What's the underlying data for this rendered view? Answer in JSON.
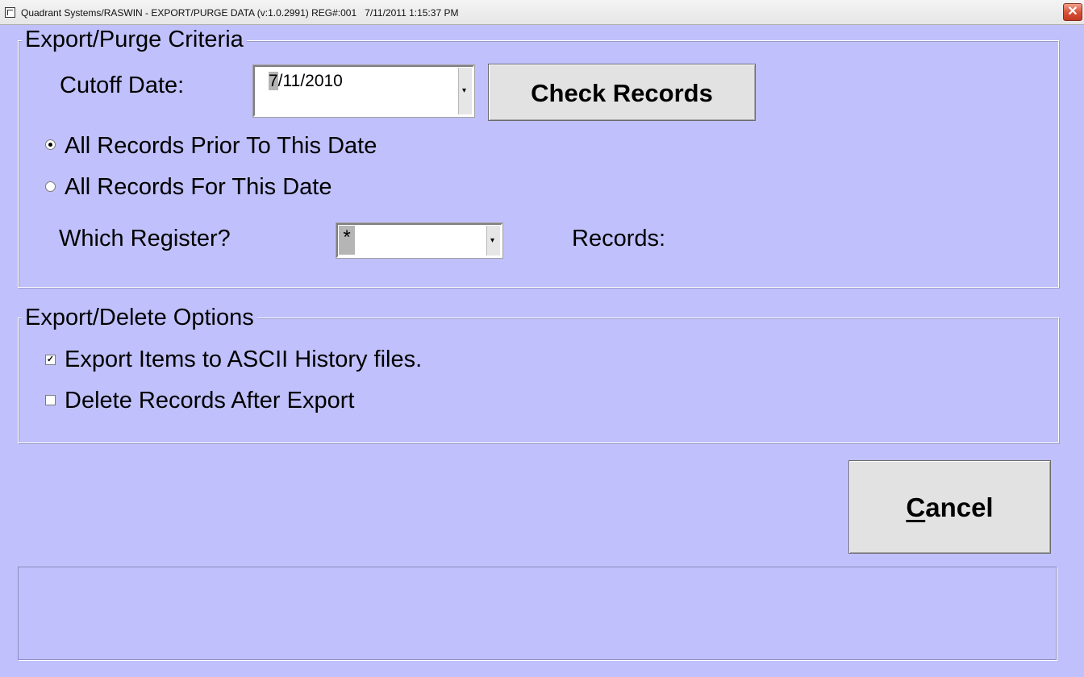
{
  "window": {
    "title": "Quadrant Systems/RASWIN - EXPORT/PURGE DATA (v:1.0.2991) REG#:001   7/11/2011 1:15:37 PM",
    "close_glyph": "✕"
  },
  "criteria": {
    "legend": "Export/Purge Criteria",
    "cutoff_label": "Cutoff Date:",
    "cutoff_value": "7/11/2010",
    "check_records_label": "Check Records",
    "radio_prior_label": "All Records Prior To This Date",
    "radio_prior_selected": true,
    "radio_for_label": "All Records For This Date",
    "radio_for_selected": false,
    "register_label": "Which Register?",
    "register_value": "*",
    "records_label": "Records:"
  },
  "options": {
    "legend": "Export/Delete Options",
    "export_label": "Export Items to ASCII History files.",
    "export_checked": true,
    "delete_label": "Delete Records After Export",
    "delete_checked": false
  },
  "actions": {
    "cancel_label": "Cancel"
  },
  "colors": {
    "background": "#c0c0fc",
    "button_face": "#e2e2e2",
    "selection": "#b5b5b5"
  }
}
